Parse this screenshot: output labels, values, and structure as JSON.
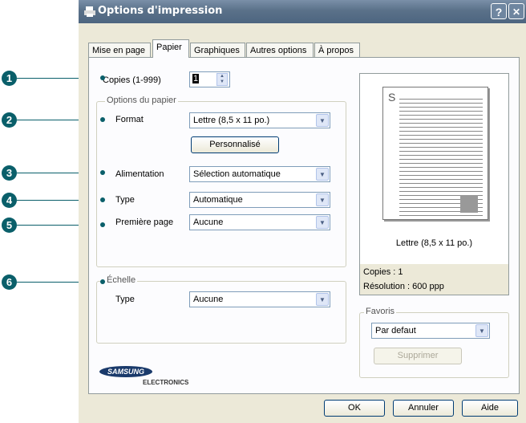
{
  "window": {
    "title": "Options d'impression",
    "help_button": "?",
    "close_button": "✕"
  },
  "tabs": [
    {
      "label": "Mise en page",
      "active": false
    },
    {
      "label": "Papier",
      "active": true
    },
    {
      "label": "Graphiques",
      "active": false
    },
    {
      "label": "Autres options",
      "active": false
    },
    {
      "label": "À propos",
      "active": false
    }
  ],
  "copies": {
    "label": "Copies (1-999)",
    "value": "1"
  },
  "paper_options": {
    "group_title": "Options du papier",
    "format_label": "Format",
    "format_value": "Lettre (8,5 x 11 po.)",
    "custom_button": "Personnalisé",
    "source_label": "Alimentation",
    "source_value": "Sélection automatique",
    "type_label": "Type",
    "type_value": "Automatique",
    "first_page_label": "Première page",
    "first_page_value": "Aucune"
  },
  "scaling": {
    "group_title": "Échelle",
    "type_label": "Type",
    "type_value": "Aucune"
  },
  "preview": {
    "page_letter": "S",
    "paper_caption": "Lettre (8,5 x 11 po.)",
    "copies_text": "Copies : 1",
    "resolution_text": "Résolution : 600 ppp"
  },
  "favorites": {
    "group_title": "Favoris",
    "value": "Par defaut",
    "delete_button": "Supprimer"
  },
  "logo": {
    "brand": "SAMSUNG",
    "sub": "ELECTRONICS"
  },
  "footer": {
    "ok": "OK",
    "cancel": "Annuler",
    "help": "Aide"
  },
  "callouts": [
    "1",
    "2",
    "3",
    "4",
    "5",
    "6"
  ],
  "colors": {
    "callout": "#0a5f6a",
    "titlebar": "#5a7189",
    "dialog_bg": "#ece9d8"
  }
}
